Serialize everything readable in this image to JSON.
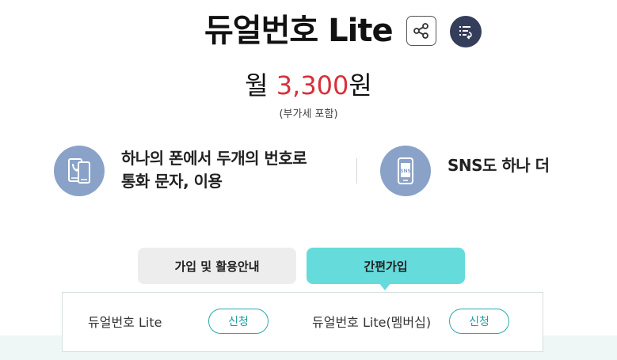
{
  "header": {
    "title": "듀얼번호 Lite",
    "share_icon": "share-icon",
    "list_icon": "list-icon"
  },
  "price": {
    "prefix": "월 ",
    "amount": "3,300",
    "suffix": "원",
    "vat_note": "(부가세 포함)",
    "amount_color": "#d8303b"
  },
  "features": [
    {
      "icon": "dual-phone-icon",
      "line1": "하나의 폰에서 두개의 번호로",
      "line2": "통화 문자, 이용"
    },
    {
      "icon": "sns-phone-icon",
      "line1": "SNS도 하나 더"
    }
  ],
  "tabs": [
    {
      "label": "가입 및 활용안내",
      "active": false
    },
    {
      "label": "간편가입",
      "active": true
    }
  ],
  "plans": [
    {
      "name": "듀얼번호 Lite",
      "button": "신청"
    },
    {
      "name": "듀얼번호 Lite(멤버십)",
      "button": "신청"
    }
  ],
  "colors": {
    "accent": "#66dbdb",
    "icon_bg": "#8aa2c8",
    "dark_button": "#343d5a"
  }
}
